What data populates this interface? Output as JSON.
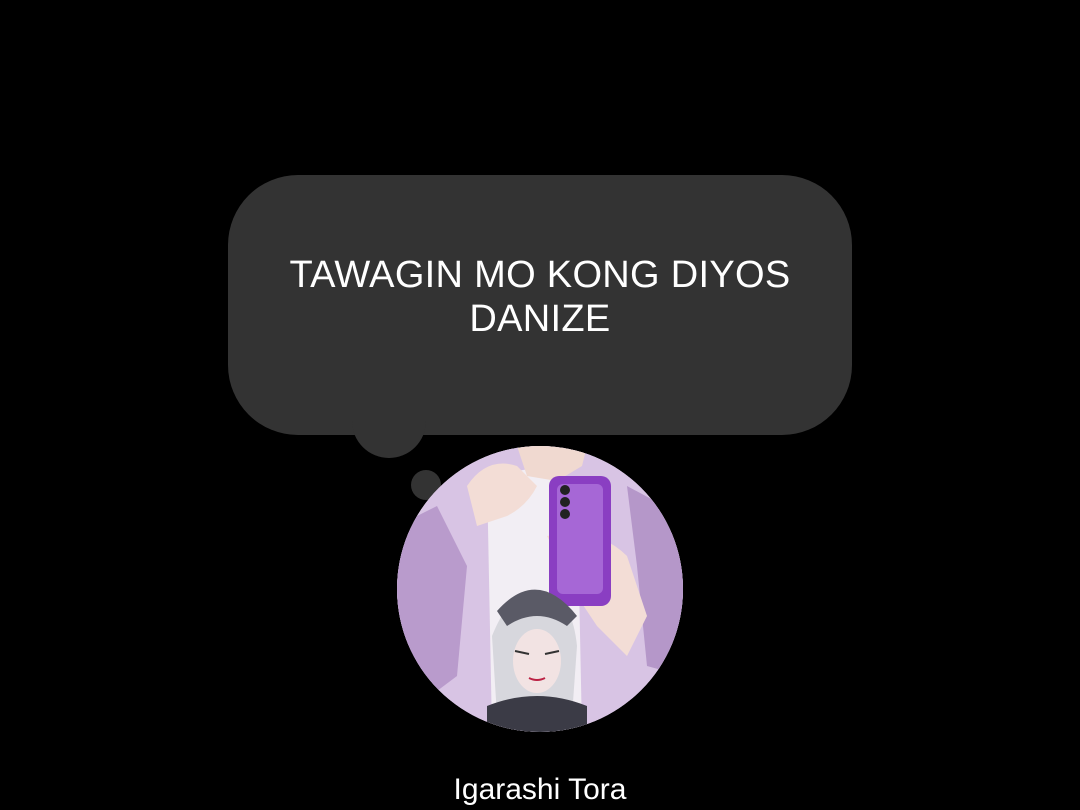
{
  "note": {
    "text": "TAWAGIN MO KONG DIYOS\nDANIZE"
  },
  "profile": {
    "name": "Igarashi Tora",
    "avatar_icon": "profile-photo-avatar"
  },
  "colors": {
    "background": "#000000",
    "bubble": "#333333",
    "text": "#ffffff"
  }
}
